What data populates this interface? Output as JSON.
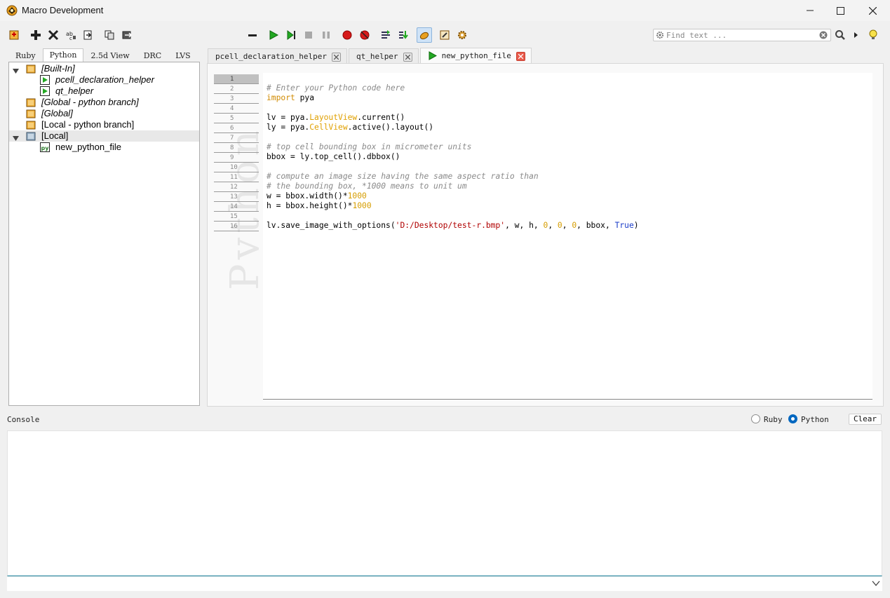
{
  "window": {
    "title": "Macro Development"
  },
  "find": {
    "placeholder": "Find text ..."
  },
  "left_tabs": [
    {
      "label": "Ruby"
    },
    {
      "label": "Python"
    },
    {
      "label": "2.5d View"
    },
    {
      "label": "DRC"
    },
    {
      "label": "LVS"
    }
  ],
  "tree": [
    {
      "label": "[Built-In]"
    },
    {
      "label": "pcell_declaration_helper"
    },
    {
      "label": "qt_helper"
    },
    {
      "label": "[Global - python branch]"
    },
    {
      "label": "[Global]"
    },
    {
      "label": "[Local - python branch]"
    },
    {
      "label": "[Local]"
    },
    {
      "label": "new_python_file"
    }
  ],
  "editor_tabs": [
    {
      "label": "pcell_declaration_helper"
    },
    {
      "label": "qt_helper"
    },
    {
      "label": "new_python_file"
    }
  ],
  "gutter": {
    "watermark": "Python",
    "lines": [
      "1",
      "2",
      "3",
      "4",
      "5",
      "6",
      "7",
      "8",
      "9",
      "10",
      "11",
      "12",
      "13",
      "14",
      "15",
      "16"
    ]
  },
  "code": {
    "l1": "# Enter your Python code here",
    "l2_kw": "import",
    "l2_rest": " pya",
    "l4_a": "lv = pya.",
    "l4_cls": "LayoutView",
    "l4_b": ".current()",
    "l5_a": "ly = pya.",
    "l5_cls": "CellView",
    "l5_b": ".active().layout()",
    "l7": "# top cell bounding box in micrometer units",
    "l8": "bbox = ly.top_cell().dbbox()",
    "l10": "# compute an image size having the same aspect ratio than",
    "l11": "# the bounding box, *1000 means to unit um",
    "l12_a": "w = bbox.width()*",
    "l12_num": "1000",
    "l13_a": "h = bbox.height()*",
    "l13_num": "1000",
    "l15_a": "lv.save_image_with_options(",
    "l15_str": "'D:/Desktop/test-r.bmp'",
    "l15_b": ", w, h, ",
    "l15_n1": "0",
    "l15_c1": ", ",
    "l15_n2": "0",
    "l15_c2": ", ",
    "l15_n3": "0",
    "l15_d": ", bbox, ",
    "l15_true": "True",
    "l15_e": ")"
  },
  "console": {
    "label": "Console",
    "radio_ruby": "Ruby",
    "radio_python": "Python",
    "selected": "Python",
    "clear_label": "Clear"
  },
  "colors": {
    "accent": "#0067c0",
    "comment": "#8a8a8a",
    "keyword": "#d08a00",
    "string": "#b00000",
    "boolean": "#1a3cc8",
    "active_tab_close": "#e95b4c"
  }
}
